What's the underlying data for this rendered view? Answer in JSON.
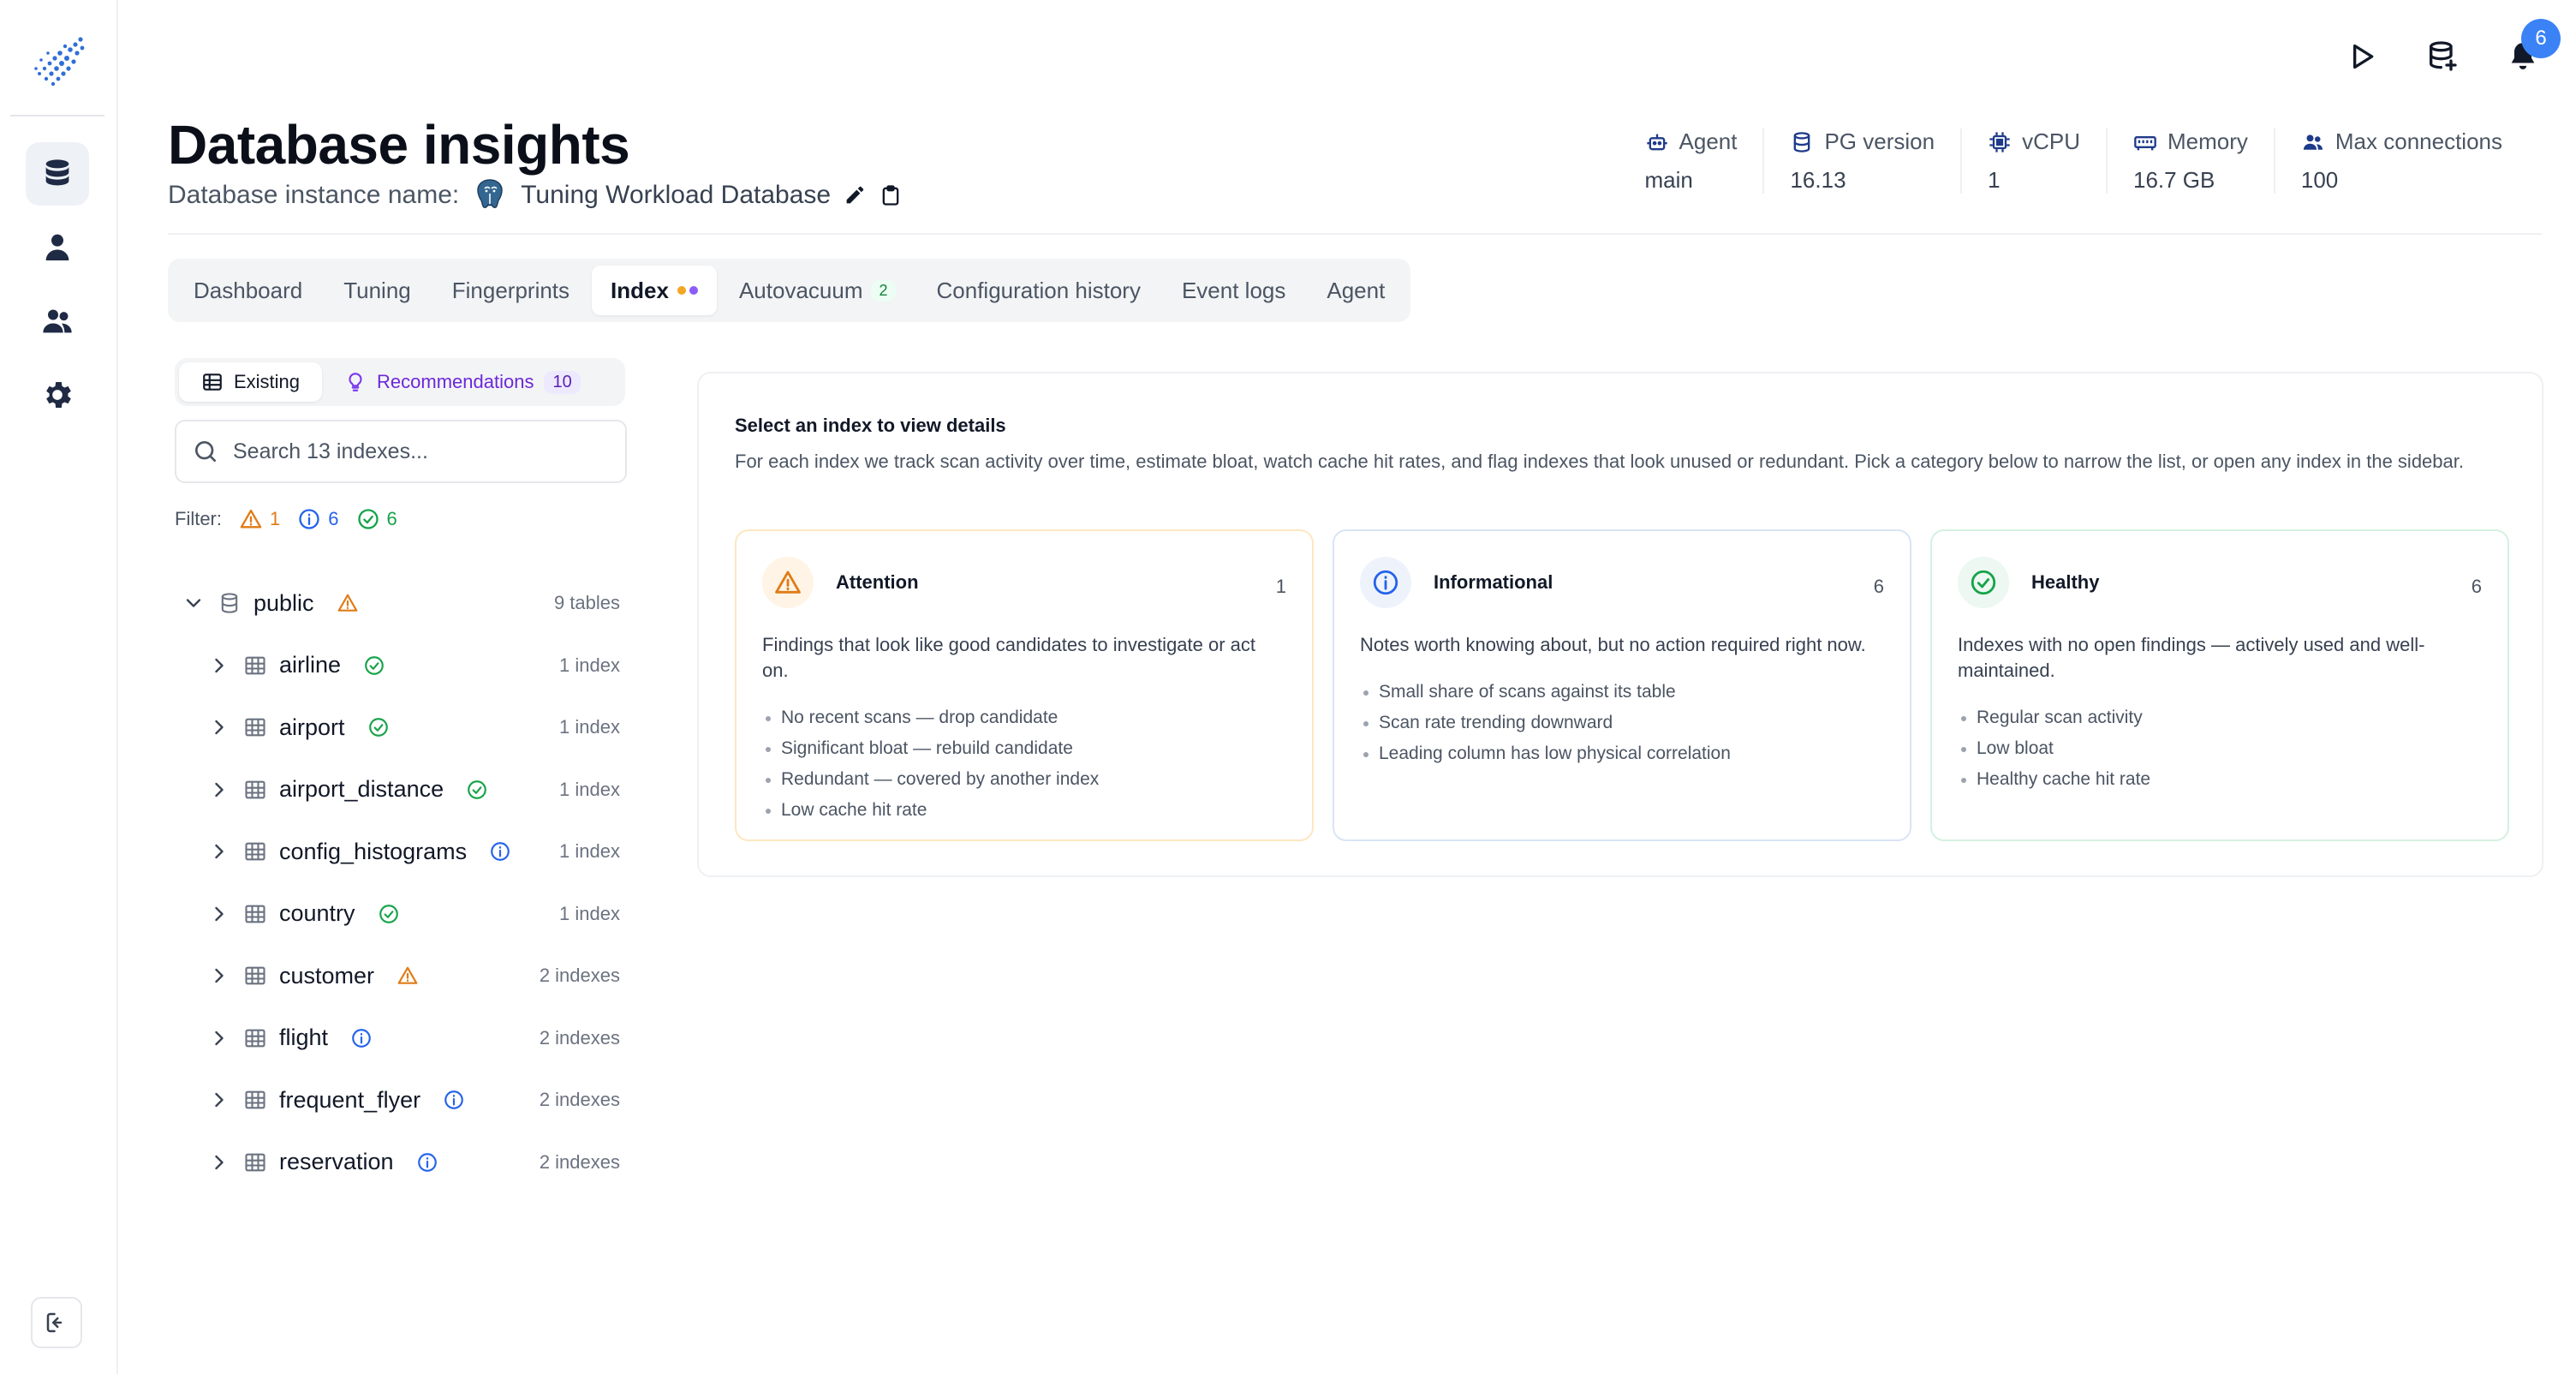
{
  "header": {
    "title": "Database insights",
    "instance_label": "Database instance name:",
    "instance_name": "Tuning Workload Database",
    "notification_count": "6"
  },
  "stats": [
    {
      "label": "Agent",
      "value": "main",
      "icon": "robot-icon"
    },
    {
      "label": "PG version",
      "value": "16.13",
      "icon": "database-icon"
    },
    {
      "label": "vCPU",
      "value": "1",
      "icon": "cpu-icon"
    },
    {
      "label": "Memory",
      "value": "16.7 GB",
      "icon": "memory-icon"
    },
    {
      "label": "Max connections",
      "value": "100",
      "icon": "users-icon"
    }
  ],
  "tabs": [
    {
      "label": "Dashboard"
    },
    {
      "label": "Tuning"
    },
    {
      "label": "Fingerprints"
    },
    {
      "label": "Index",
      "active": true
    },
    {
      "label": "Autovacuum",
      "count": "2"
    },
    {
      "label": "Configuration history"
    },
    {
      "label": "Event logs"
    },
    {
      "label": "Agent"
    }
  ],
  "segmented": {
    "existing": "Existing",
    "recommendations": "Recommendations",
    "recommendations_count": "10"
  },
  "search": {
    "placeholder": "Search 13 indexes..."
  },
  "filter": {
    "label": "Filter:",
    "warn": "1",
    "info": "6",
    "ok": "6"
  },
  "tree": {
    "schema": {
      "name": "public",
      "count": "9 tables",
      "status": "warn"
    },
    "tables": [
      {
        "name": "airline",
        "count": "1 index",
        "status": "ok"
      },
      {
        "name": "airport",
        "count": "1 index",
        "status": "ok"
      },
      {
        "name": "airport_distance",
        "count": "1 index",
        "status": "ok"
      },
      {
        "name": "config_histograms",
        "count": "1 index",
        "status": "info"
      },
      {
        "name": "country",
        "count": "1 index",
        "status": "ok"
      },
      {
        "name": "customer",
        "count": "2 indexes",
        "status": "warn"
      },
      {
        "name": "flight",
        "count": "2 indexes",
        "status": "info"
      },
      {
        "name": "frequent_flyer",
        "count": "2 indexes",
        "status": "info"
      },
      {
        "name": "reservation",
        "count": "2 indexes",
        "status": "info"
      }
    ]
  },
  "details": {
    "heading": "Select an index to view details",
    "description": "For each index we track scan activity over time, estimate bloat, watch cache hit rates, and flag indexes that look unused or redundant. Pick a category below to narrow the list, or open any index in the sidebar.",
    "cards": [
      {
        "title": "Attention",
        "count": "1",
        "kind": "warn",
        "desc": "Findings that look like good candidates to investigate or act on.",
        "items": [
          "No recent scans — drop candidate",
          "Significant bloat — rebuild candidate",
          "Redundant — covered by another index",
          "Low cache hit rate"
        ]
      },
      {
        "title": "Informational",
        "count": "6",
        "kind": "info",
        "desc": "Notes worth knowing about, but no action required right now.",
        "items": [
          "Small share of scans against its table",
          "Scan rate trending downward",
          "Leading column has low physical correlation"
        ]
      },
      {
        "title": "Healthy",
        "count": "6",
        "kind": "ok",
        "desc": "Indexes with no open findings — actively used and well-maintained.",
        "items": [
          "Regular scan activity",
          "Low bloat",
          "Healthy cache hit rate"
        ]
      }
    ]
  },
  "colors": {
    "warn": "#e07b16",
    "info": "#2563eb",
    "ok": "#16a34a",
    "accent": "#3b82f6",
    "reco": "#6d28d9"
  }
}
